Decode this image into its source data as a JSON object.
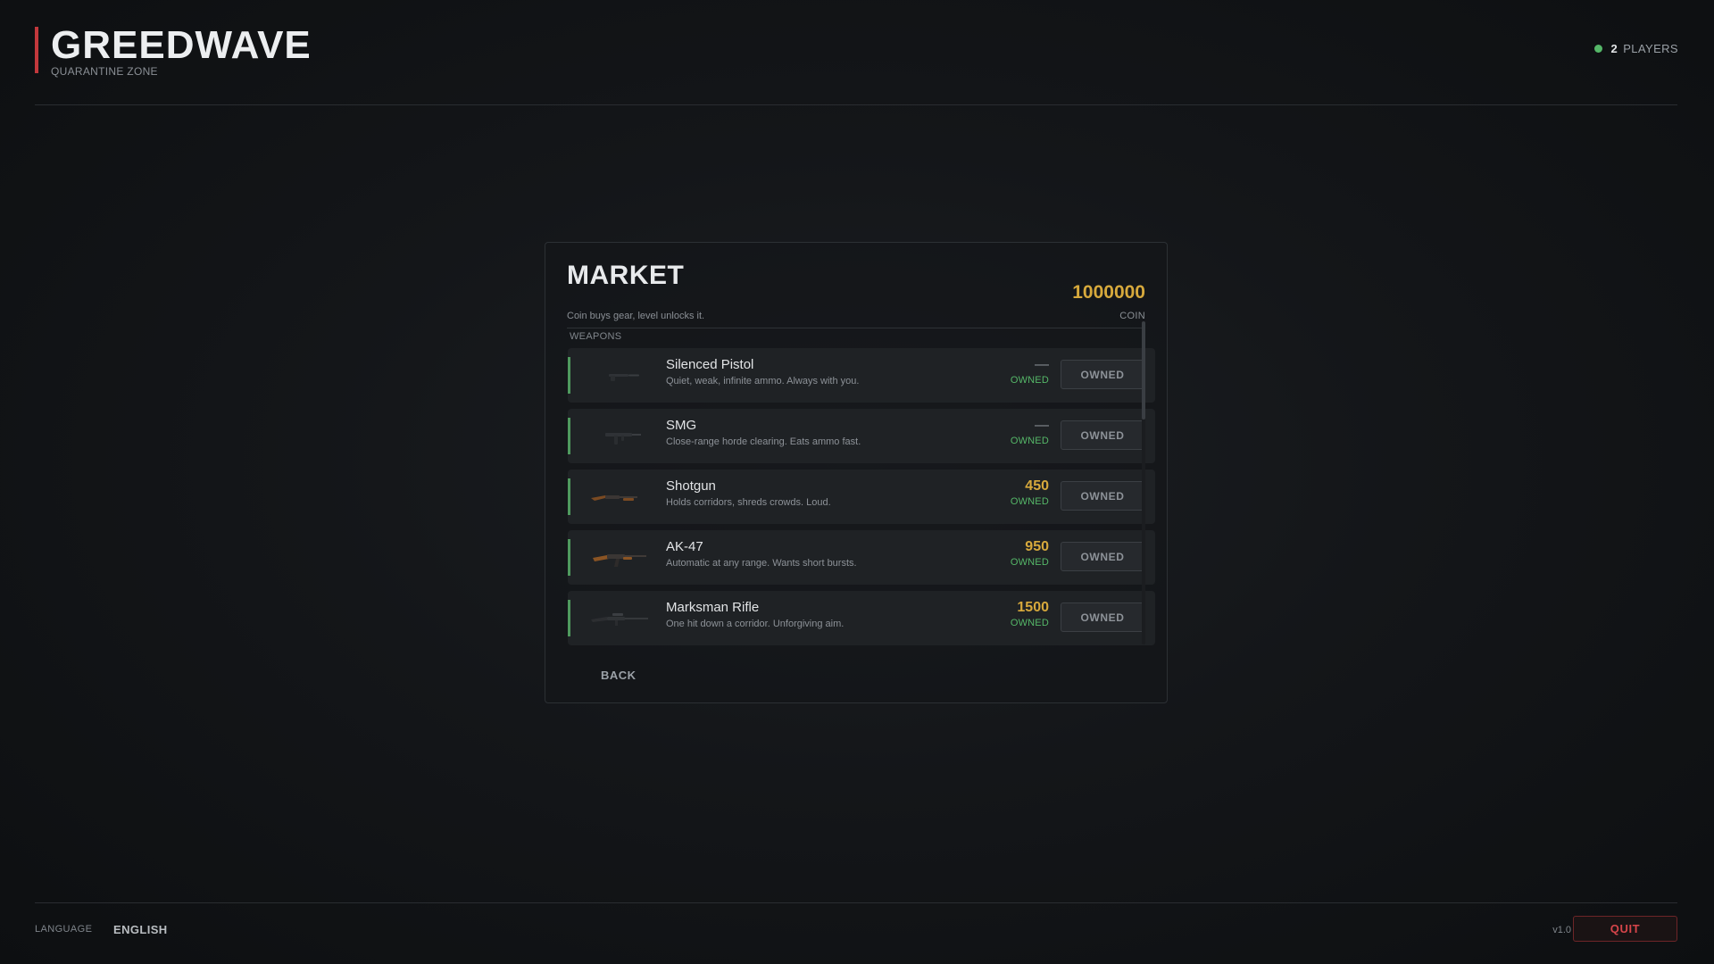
{
  "header": {
    "title": "GREEDWAVE",
    "subtitle": "QUARANTINE ZONE",
    "players_count": "2",
    "players_label": "PLAYERS",
    "status_color": "#55b768"
  },
  "market": {
    "title": "MARKET",
    "subtitle": "Coin buys gear, level unlocks it.",
    "coin_amount": "1000000",
    "coin_label": "COIN",
    "section_label": "WEAPONS",
    "items": [
      {
        "name": "Silenced Pistol",
        "description": "Quiet, weak, infinite ammo. Always with you.",
        "price": "—",
        "status": "OWNED",
        "button": "OWNED",
        "icon": "pistol-icon"
      },
      {
        "name": "SMG",
        "description": "Close-range horde clearing. Eats ammo fast.",
        "price": "—",
        "status": "OWNED",
        "button": "OWNED",
        "icon": "smg-icon"
      },
      {
        "name": "Shotgun",
        "description": "Holds corridors, shreds crowds. Loud.",
        "price": "450",
        "status": "OWNED",
        "button": "OWNED",
        "icon": "shotgun-icon"
      },
      {
        "name": "AK-47",
        "description": "Automatic at any range. Wants short bursts.",
        "price": "950",
        "status": "OWNED",
        "button": "OWNED",
        "icon": "rifle-icon"
      },
      {
        "name": "Marksman Rifle",
        "description": "One hit down a corridor. Unforgiving aim.",
        "price": "1500",
        "status": "OWNED",
        "button": "OWNED",
        "icon": "sniper-icon"
      }
    ],
    "back_label": "BACK"
  },
  "footer": {
    "language_label": "LANGUAGE",
    "language_value": "ENGLISH",
    "version": "v1.0",
    "quit_label": "QUIT"
  },
  "colors": {
    "accent_red": "#c2383c",
    "coin_gold": "#d7a93c",
    "owned_green": "#55b768"
  }
}
